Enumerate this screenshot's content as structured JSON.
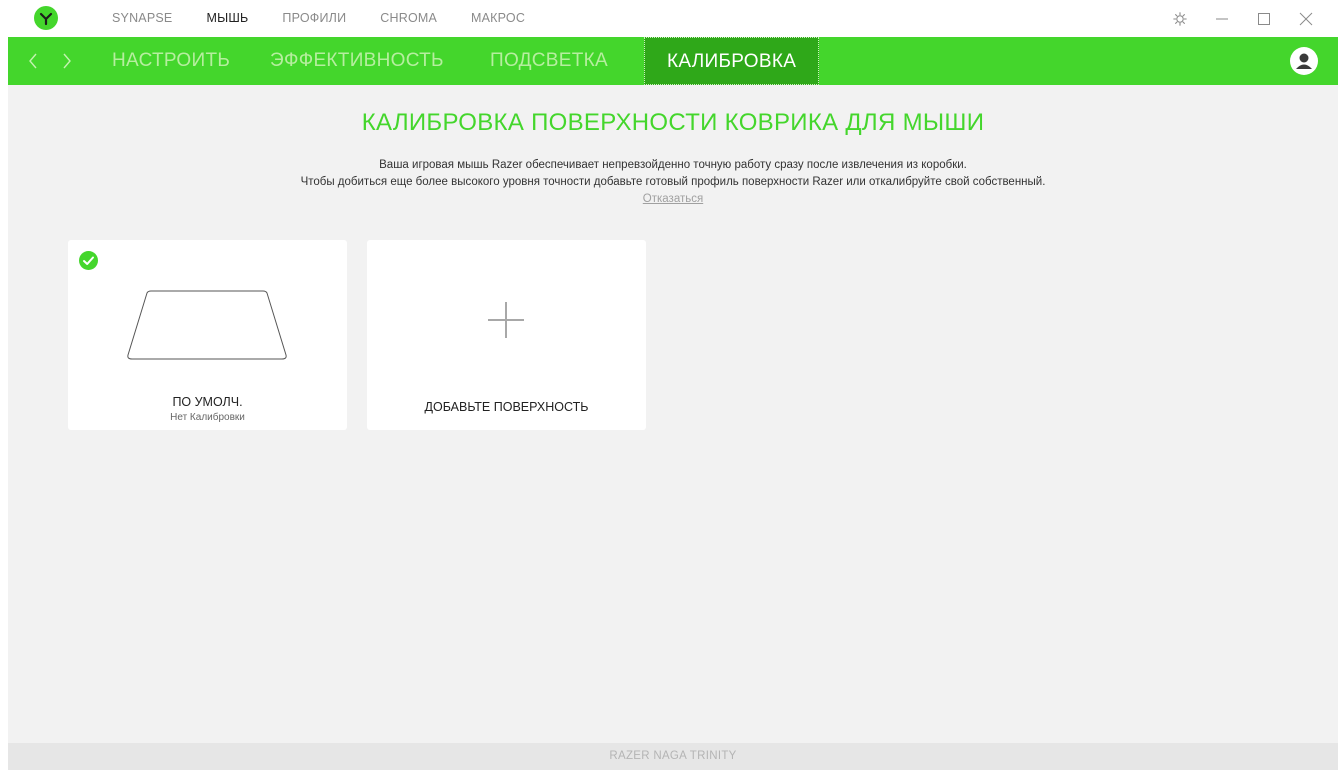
{
  "topnav": {
    "items": [
      {
        "label": "SYNAPSE",
        "active": false
      },
      {
        "label": "МЫШЬ",
        "active": true
      },
      {
        "label": "ПРОФИЛИ",
        "active": false
      },
      {
        "label": "CHROMA",
        "active": false
      },
      {
        "label": "МАКРОС",
        "active": false
      }
    ]
  },
  "tabs": {
    "items": [
      {
        "label": "НАСТРОИТЬ",
        "active": false
      },
      {
        "label": "ЭФФЕКТИВНОСТЬ",
        "active": false
      },
      {
        "label": "ПОДСВЕТКА",
        "active": false
      },
      {
        "label": "КАЛИБРОВКА",
        "active": true
      }
    ]
  },
  "main": {
    "heading": "КАЛИБРОВКА ПОВЕРХНОСТИ КОВРИКА ДЛЯ МЫШИ",
    "description_line1": "Ваша игровая мышь Razer обеспечивает непревзойденно точную работу сразу после извлечения из коробки.",
    "description_line2": "Чтобы добиться еще более высокого уровня точности добавьте готовый профиль поверхности Razer или откалибруйте свой собственный.",
    "decline_link": "Отказаться"
  },
  "cards": {
    "default": {
      "title": "ПО УМОЛЧ.",
      "subtitle": "Нет Калибровки",
      "selected": true
    },
    "add": {
      "title": "ДОБАВЬТЕ ПОВЕРХНОСТЬ"
    }
  },
  "footer": {
    "device_name": "RAZER NAGA TRINITY"
  },
  "icons": {
    "logo": "razer-logo-icon",
    "settings": "gear-icon",
    "minimize": "minimize-icon",
    "maximize": "maximize-icon",
    "close": "close-icon",
    "back": "chevron-left-icon",
    "forward": "chevron-right-icon",
    "profile": "user-avatar-icon",
    "check": "check-icon",
    "mousepad": "mousepad-icon",
    "add": "plus-icon"
  },
  "colors": {
    "accent": "#44d62c",
    "active_tab": "#2fa819",
    "inactive_tab_text": "#b6ee9f",
    "background": "#f2f2f2"
  }
}
